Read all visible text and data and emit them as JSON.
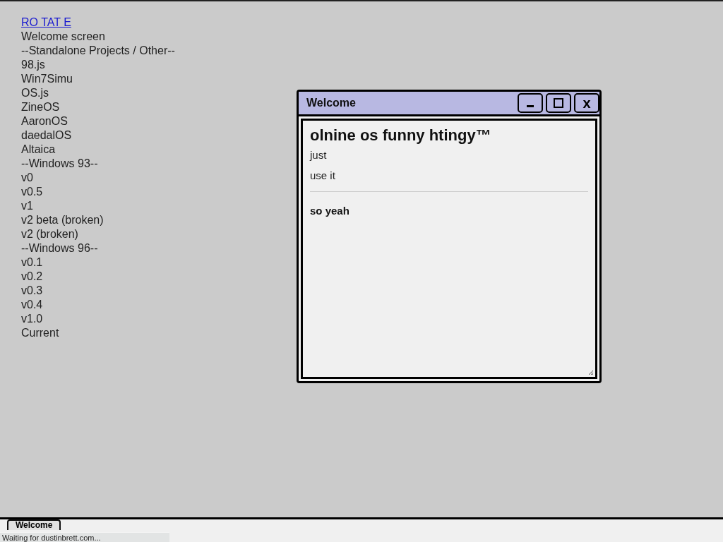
{
  "menu": [
    {
      "kind": "link",
      "text": "RO TAT E"
    },
    {
      "kind": "text",
      "text": "Welcome screen"
    },
    {
      "kind": "text",
      "text": "--Standalone Projects / Other--"
    },
    {
      "kind": "text",
      "text": "98.js"
    },
    {
      "kind": "text",
      "text": "Win7Simu"
    },
    {
      "kind": "text",
      "text": "OS.js"
    },
    {
      "kind": "text",
      "text": "ZineOS"
    },
    {
      "kind": "text",
      "text": "AaronOS"
    },
    {
      "kind": "text",
      "text": "daedalOS"
    },
    {
      "kind": "text",
      "text": "Altaica"
    },
    {
      "kind": "text",
      "text": "--Windows 93--"
    },
    {
      "kind": "text",
      "text": "v0"
    },
    {
      "kind": "text",
      "text": "v0.5"
    },
    {
      "kind": "text",
      "text": "v1"
    },
    {
      "kind": "text",
      "text": "v2 beta (broken)"
    },
    {
      "kind": "text",
      "text": "v2 (broken)"
    },
    {
      "kind": "text",
      "text": "--Windows 96--"
    },
    {
      "kind": "text",
      "text": "v0.1"
    },
    {
      "kind": "text",
      "text": "v0.2"
    },
    {
      "kind": "text",
      "text": "v0.3"
    },
    {
      "kind": "text",
      "text": "v0.4"
    },
    {
      "kind": "text",
      "text": "v1.0"
    },
    {
      "kind": "text",
      "text": "Current"
    }
  ],
  "window": {
    "title": "Welcome",
    "buttons": [
      {
        "kind": "minimize"
      },
      {
        "kind": "maximize"
      },
      {
        "kind": "close",
        "text": "x"
      }
    ],
    "heading": "olnine os funny htingy™",
    "paragraphs": [
      "just",
      "use it"
    ],
    "footer": "so yeah"
  },
  "taskbar": {
    "items": [
      {
        "label": "Welcome"
      }
    ]
  },
  "status": "Waiting for dustinbrett.com..."
}
